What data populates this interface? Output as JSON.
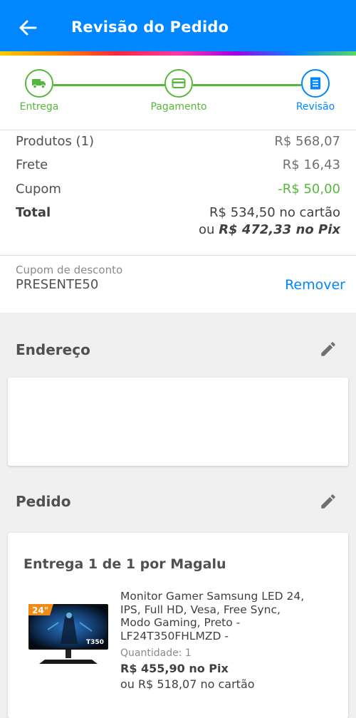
{
  "header": {
    "title": "Revisão do Pedido",
    "background_color": "#0086ff"
  },
  "stepper": {
    "steps": [
      {
        "label": "Entrega",
        "icon": "truck-icon",
        "state": "done"
      },
      {
        "label": "Pagamento",
        "icon": "credit-card-icon",
        "state": "done"
      },
      {
        "label": "Revisão",
        "icon": "receipt-icon",
        "state": "current"
      }
    ],
    "done_color": "#56b83b",
    "current_color": "#0086ff"
  },
  "summary": {
    "products_label": "Produtos (1)",
    "products_value": "R$ 568,07",
    "shipping_label": "Frete",
    "shipping_value": "R$ 16,43",
    "coupon_label": "Cupom",
    "coupon_value": "-R$ 50,00",
    "total_label": "Total",
    "total_card": "R$ 534,50 no cartão",
    "total_pix_prefix": "ou",
    "total_pix_value": "R$ 472,33 no Pix"
  },
  "coupon": {
    "label": "Cupom de desconto",
    "code": "PRESENTE50",
    "remove_label": "Remover"
  },
  "address": {
    "section_title": "Endereço"
  },
  "order": {
    "section_title": "Pedido",
    "delivery_title": "Entrega 1 de 1 por Magalu",
    "product": {
      "name": "Monitor Gamer Samsung LED 24, IPS, Full HD, Vesa, Free Sync, Modo Gaming, Preto - LF24T350FHLMZD -",
      "image_badge": "24\"",
      "image_model": "T350",
      "quantity_label": "Quantidade:",
      "quantity_value": "1",
      "price_pix": "R$ 455,90 no Pix",
      "price_card": "ou R$ 518,07 no cartão"
    }
  }
}
